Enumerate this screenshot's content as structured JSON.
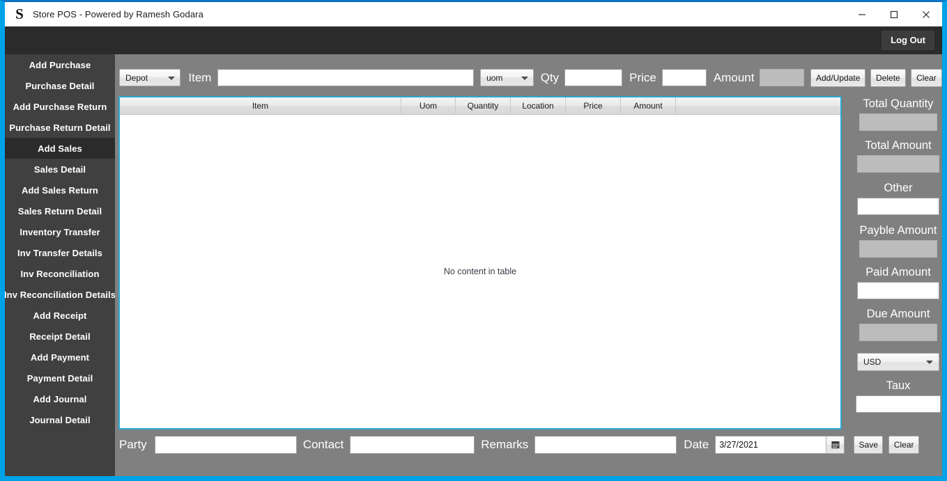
{
  "window": {
    "logo_letter": "S",
    "title": "Store POS - Powered by Ramesh Godara",
    "minimize": "minimize-icon",
    "maximize": "maximize-icon",
    "close": "close-icon",
    "accent_color": "#00a2e8",
    "header_color": "#2b2b2b",
    "sidebar_color": "#404040",
    "body_color": "#808080"
  },
  "header": {
    "logout_label": "Log Out"
  },
  "sidebar": {
    "items": [
      {
        "label": "Add Purchase",
        "active": false
      },
      {
        "label": "Purchase Detail",
        "active": false
      },
      {
        "label": "Add Purchase Return",
        "active": false
      },
      {
        "label": "Purchase Return Detail",
        "active": false
      },
      {
        "label": "Add Sales",
        "active": true
      },
      {
        "label": "Sales Detail",
        "active": false
      },
      {
        "label": "Add Sales Return",
        "active": false
      },
      {
        "label": "Sales Return Detail",
        "active": false
      },
      {
        "label": "Inventory Transfer",
        "active": false
      },
      {
        "label": "Inv Transfer Details",
        "active": false
      },
      {
        "label": "Inv Reconciliation",
        "active": false
      },
      {
        "label": "Inv Reconciliation Details",
        "active": false
      },
      {
        "label": "Add Receipt",
        "active": false
      },
      {
        "label": "Receipt Detail",
        "active": false
      },
      {
        "label": "Add Payment",
        "active": false
      },
      {
        "label": "Payment Detail",
        "active": false
      },
      {
        "label": "Add Journal",
        "active": false
      },
      {
        "label": "Journal Detail",
        "active": false
      }
    ]
  },
  "toolbar": {
    "depot_selected": "Depot",
    "item_label": "Item",
    "item_value": "",
    "uom_selected": "uom",
    "qty_label": "Qty",
    "qty_value": "",
    "price_label": "Price",
    "price_value": "",
    "amount_label": "Amount",
    "amount_value": "",
    "add_update_label": "Add/Update",
    "delete_label": "Delete",
    "clear_label": "Clear"
  },
  "grid": {
    "columns": [
      "Item",
      "Uom",
      "Quantity",
      "Location",
      "Price",
      "Amount",
      ""
    ],
    "rows": [],
    "empty_message": "No content in table"
  },
  "totals": {
    "total_quantity_label": "Total Quantity",
    "total_quantity_value": "",
    "total_amount_label": "Total Amount",
    "total_amount_value": "",
    "other_label": "Other",
    "other_value": "",
    "payble_amount_label": "Payble Amount",
    "payble_amount_value": "",
    "paid_amount_label": "Paid Amount",
    "paid_amount_value": "",
    "due_amount_label": "Due Amount",
    "due_amount_value": "",
    "currency_selected": "USD",
    "taux_label": "Taux",
    "taux_value": ""
  },
  "footer": {
    "party_label": "Party",
    "party_value": "",
    "contact_label": "Contact",
    "contact_value": "",
    "remarks_label": "Remarks",
    "remarks_value": "",
    "date_label": "Date",
    "date_value": "3/27/2021",
    "calendar_icon": "calendar-icon",
    "save_label": "Save",
    "clear_label": "Clear"
  }
}
